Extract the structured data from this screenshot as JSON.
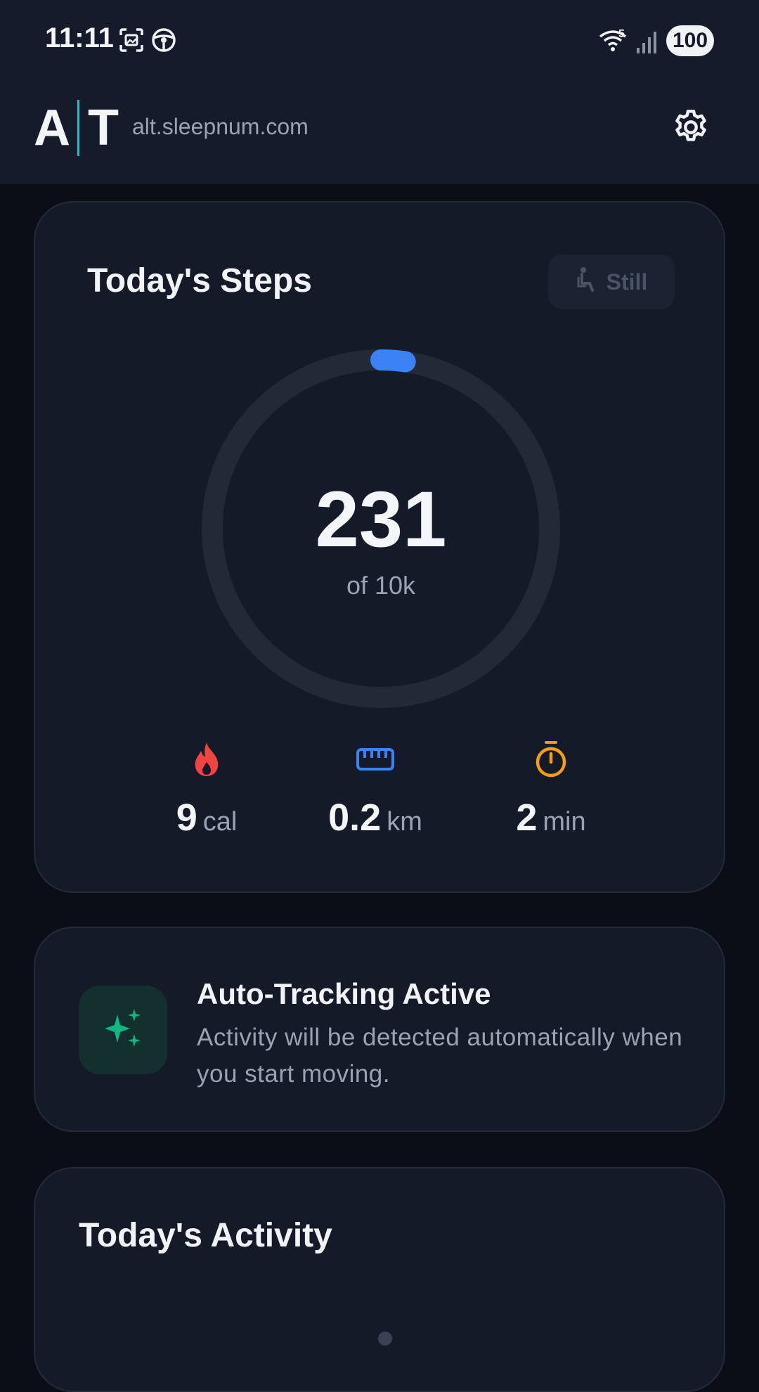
{
  "status_bar": {
    "time": "11:11",
    "wifi_badge": "5",
    "battery": "100",
    "icons": [
      "screenshot-icon",
      "steering-wheel-icon",
      "wifi-icon",
      "signal-icon"
    ]
  },
  "header": {
    "logo_left": "A",
    "logo_right": "T",
    "url": "alt.sleepnum.com",
    "settings_icon": "gear-icon"
  },
  "steps_card": {
    "title": "Today's Steps",
    "activity_state": "Still",
    "activity_state_icon": "seated-person-icon",
    "steps": "231",
    "goal": "of 10k",
    "progress": 0.0231,
    "stats": [
      {
        "icon": "flame-icon",
        "value": "9",
        "unit": "cal",
        "color": "#ef4444"
      },
      {
        "icon": "ruler-icon",
        "value": "0.2",
        "unit": "km",
        "color": "#3b82f6"
      },
      {
        "icon": "stopwatch-icon",
        "value": "2",
        "unit": "min",
        "color": "#f59e0b"
      }
    ]
  },
  "auto_tracking": {
    "title": "Auto-Tracking Active",
    "description": "Activity will be detected automatically when you start moving.",
    "icon": "sparkles-icon",
    "accent": "#10b981"
  },
  "activity_card": {
    "title": "Today's Activity"
  },
  "colors": {
    "background": "#0b0e16",
    "card": "#141a27",
    "ring_track": "#222a38",
    "ring_progress": "#3b82f6",
    "logo_accent": "#2ab9c6"
  }
}
